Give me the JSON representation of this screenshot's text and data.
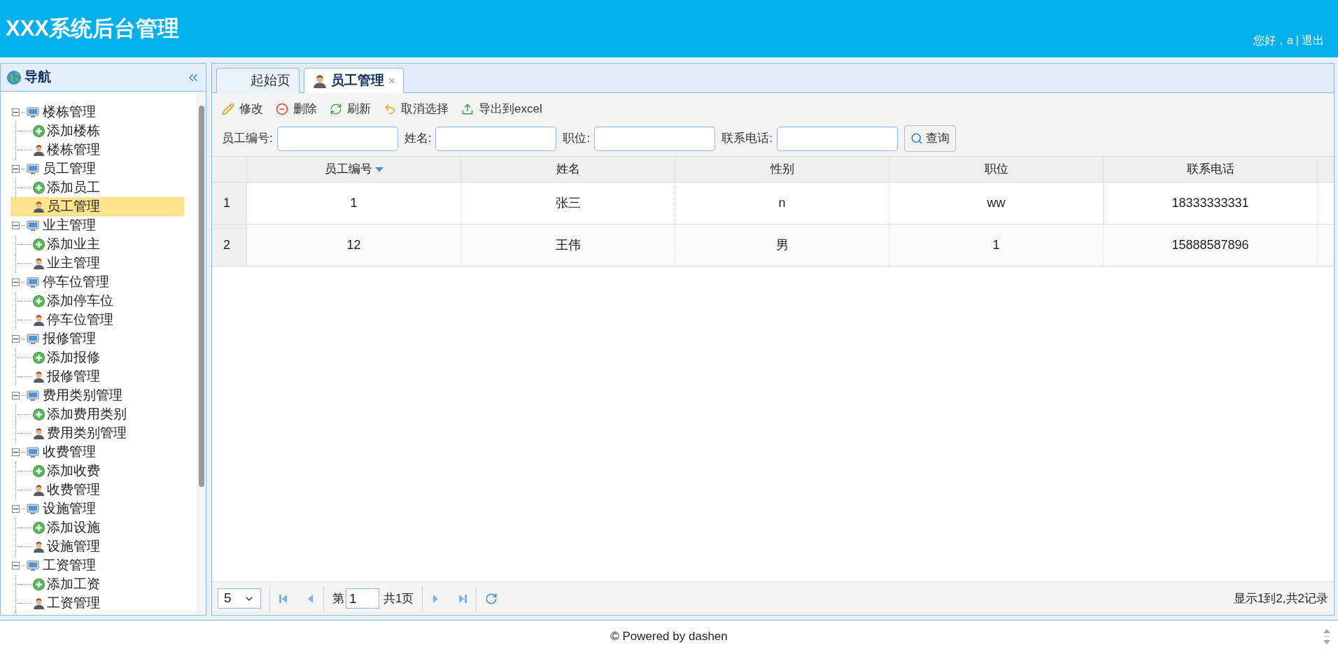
{
  "header": {
    "title": "XXX系统后台管理",
    "greeting": "您好，a",
    "separator": "|",
    "logout": "退出"
  },
  "sidebar": {
    "title": "导航",
    "tree": [
      {
        "label": "楼栋管理",
        "expanded": true,
        "children": [
          {
            "label": "添加楼栋",
            "kind": "add",
            "selected": false
          },
          {
            "label": "楼栋管理",
            "kind": "manage",
            "selected": false
          }
        ]
      },
      {
        "label": "员工管理",
        "expanded": true,
        "children": [
          {
            "label": "添加员工",
            "kind": "add",
            "selected": false
          },
          {
            "label": "员工管理",
            "kind": "manage",
            "selected": true
          }
        ]
      },
      {
        "label": "业主管理",
        "expanded": true,
        "children": [
          {
            "label": "添加业主",
            "kind": "add",
            "selected": false
          },
          {
            "label": "业主管理",
            "kind": "manage",
            "selected": false
          }
        ]
      },
      {
        "label": "停车位管理",
        "expanded": true,
        "children": [
          {
            "label": "添加停车位",
            "kind": "add",
            "selected": false
          },
          {
            "label": "停车位管理",
            "kind": "manage",
            "selected": false
          }
        ]
      },
      {
        "label": "报修管理",
        "expanded": true,
        "children": [
          {
            "label": "添加报修",
            "kind": "add",
            "selected": false
          },
          {
            "label": "报修管理",
            "kind": "manage",
            "selected": false
          }
        ]
      },
      {
        "label": "费用类别管理",
        "expanded": true,
        "children": [
          {
            "label": "添加费用类别",
            "kind": "add",
            "selected": false
          },
          {
            "label": "费用类别管理",
            "kind": "manage",
            "selected": false
          }
        ]
      },
      {
        "label": "收费管理",
        "expanded": true,
        "children": [
          {
            "label": "添加收费",
            "kind": "add",
            "selected": false
          },
          {
            "label": "收费管理",
            "kind": "manage",
            "selected": false
          }
        ]
      },
      {
        "label": "设施管理",
        "expanded": true,
        "children": [
          {
            "label": "添加设施",
            "kind": "add",
            "selected": false
          },
          {
            "label": "设施管理",
            "kind": "manage",
            "selected": false
          }
        ]
      },
      {
        "label": "工资管理",
        "expanded": true,
        "children": [
          {
            "label": "添加工资",
            "kind": "add",
            "selected": false
          },
          {
            "label": "工资管理",
            "kind": "manage",
            "selected": false
          }
        ]
      }
    ]
  },
  "tabs": [
    {
      "label": "起始页",
      "kind": "home",
      "selected": false,
      "closable": false
    },
    {
      "label": "员工管理",
      "kind": "page",
      "selected": true,
      "closable": true
    }
  ],
  "close_mark": "×",
  "toolbar": [
    {
      "label": "修改",
      "kind": "edit"
    },
    {
      "label": "删除",
      "kind": "delete"
    },
    {
      "label": "刷新",
      "kind": "refresh"
    },
    {
      "label": "取消选择",
      "kind": "undo"
    },
    {
      "label": "导出到excel",
      "kind": "export"
    }
  ],
  "search": {
    "fields": [
      {
        "label": "员工编号:"
      },
      {
        "label": "姓名:"
      },
      {
        "label": "职位:"
      },
      {
        "label": "联系电话:"
      }
    ],
    "button": "查询"
  },
  "table": {
    "columns": [
      {
        "label": "员工编号",
        "sorted": true
      },
      {
        "label": "姓名",
        "sorted": false
      },
      {
        "label": "性别",
        "sorted": false
      },
      {
        "label": "职位",
        "sorted": false
      },
      {
        "label": "联系电话",
        "sorted": false
      }
    ],
    "rows": [
      {
        "number": "1",
        "cells": [
          "1",
          "张三",
          "n",
          "ww",
          "18333333331"
        ]
      },
      {
        "number": "2",
        "cells": [
          "12",
          "王伟",
          "男",
          "1",
          "15888587896"
        ]
      }
    ]
  },
  "pager": {
    "page_size": "5",
    "page_prefix": "第",
    "page": "1",
    "page_total": "共1页",
    "info": "显示1到2,共2记录"
  },
  "footer": "© Powered by dashen"
}
